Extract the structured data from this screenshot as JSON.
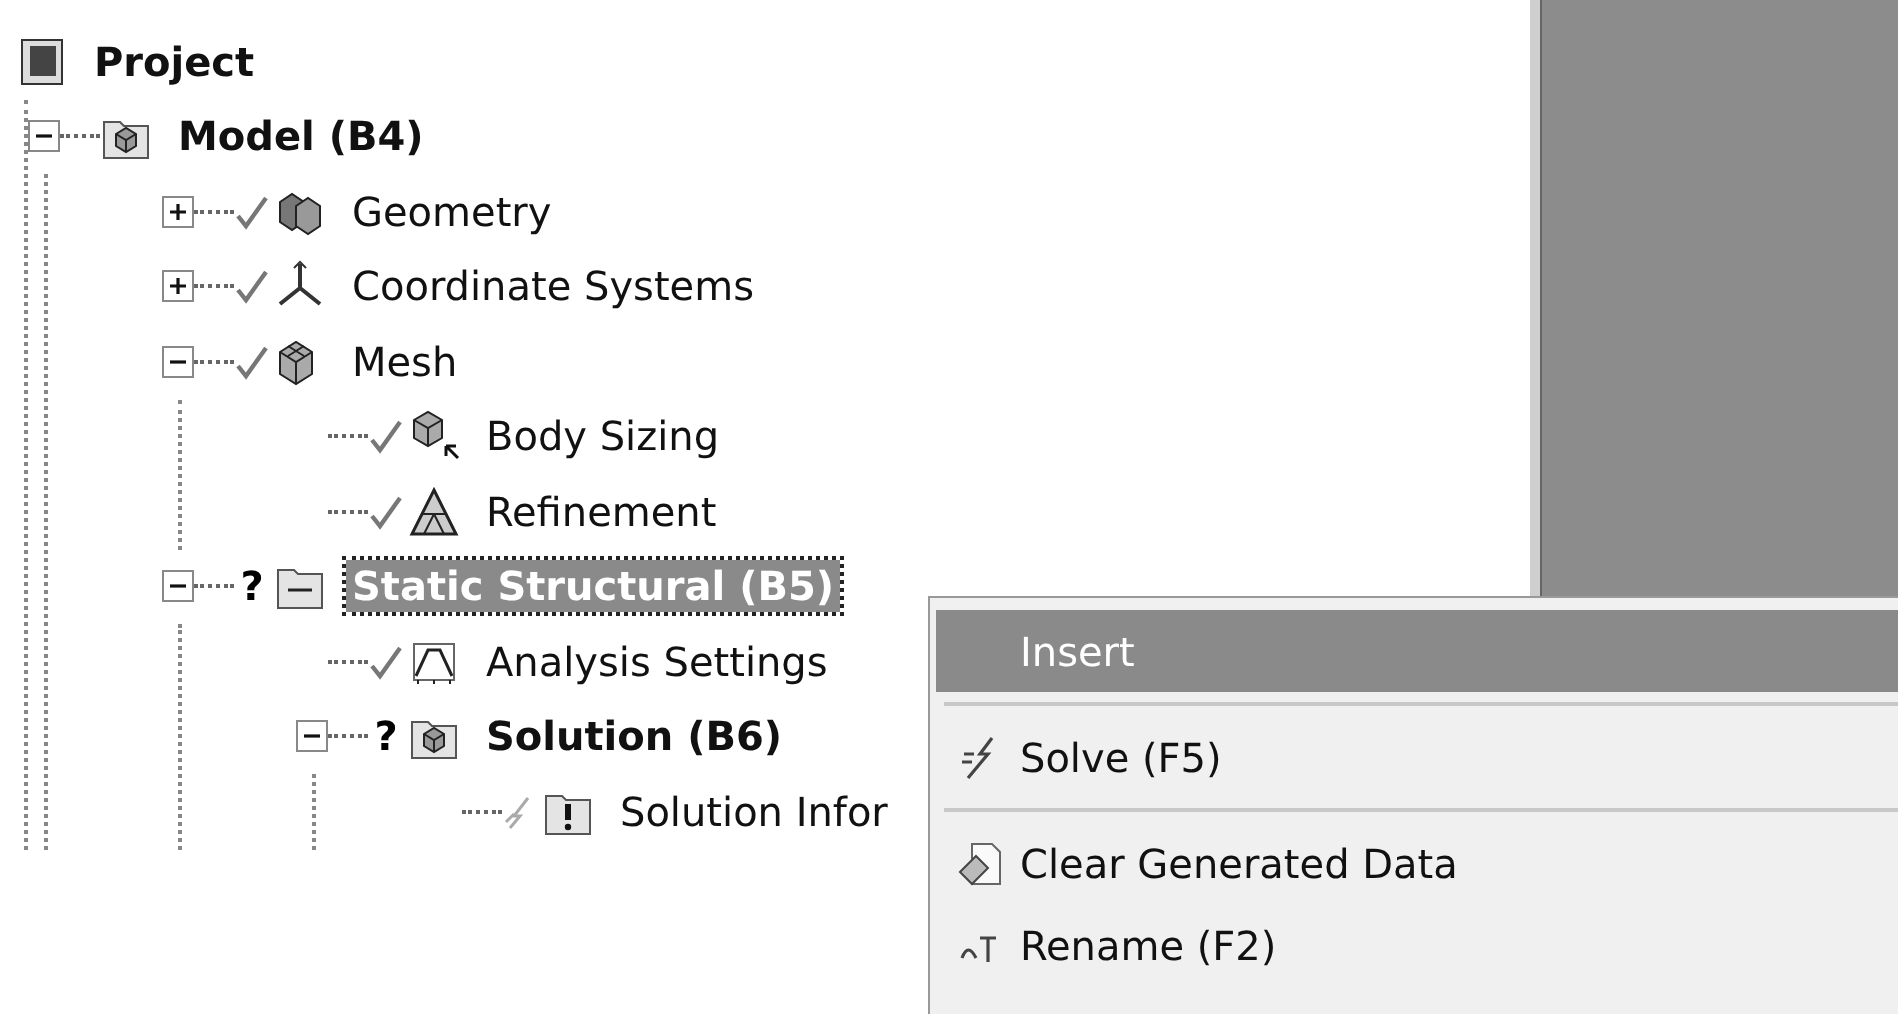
{
  "tree": [
    {
      "label": "Project",
      "kind": "project",
      "bold": true,
      "done": false,
      "selected": false,
      "children": [
        {
          "label": "Model (B4)",
          "kind": "model",
          "bold": true,
          "done": false,
          "expanded": true,
          "selected": false,
          "children": [
            {
              "label": "Geometry",
              "kind": "geometry",
              "bold": false,
              "done": true,
              "expanded": false,
              "selected": false
            },
            {
              "label": "Coordinate Systems",
              "kind": "coordinates",
              "bold": false,
              "done": true,
              "expanded": false,
              "selected": false
            },
            {
              "label": "Mesh",
              "kind": "mesh",
              "bold": false,
              "done": true,
              "expanded": true,
              "selected": false,
              "children": [
                {
                  "label": "Body Sizing",
                  "kind": "sizing",
                  "bold": false,
                  "done": true,
                  "selected": false
                },
                {
                  "label": "Refinement",
                  "kind": "refinement",
                  "bold": false,
                  "done": true,
                  "selected": false
                }
              ]
            },
            {
              "label": "Static Structural (B5)",
              "kind": "environment",
              "marker": "?",
              "bold": true,
              "done": false,
              "expanded": true,
              "selected": true,
              "children": [
                {
                  "label": "Analysis Settings",
                  "kind": "analysis",
                  "bold": false,
                  "done": true,
                  "selected": false
                },
                {
                  "label": "Solution (B6)",
                  "kind": "model",
                  "marker": "?",
                  "bold": true,
                  "done": false,
                  "expanded": true,
                  "selected": false,
                  "children": [
                    {
                      "label": "Solution Infor",
                      "kind": "info",
                      "bold": false,
                      "done": false,
                      "solving": true,
                      "selected": false
                    }
                  ]
                }
              ]
            }
          ]
        }
      ]
    }
  ],
  "context_menu": [
    {
      "kind": "item",
      "label": "Insert",
      "selected": true
    },
    {
      "kind": "separator"
    },
    {
      "kind": "item",
      "label": "Solve (F5)",
      "selected": false
    },
    {
      "kind": "separator"
    },
    {
      "kind": "item",
      "label": "Clear Generated Data",
      "selected": false
    },
    {
      "kind": "item",
      "label": "Rename (F2)",
      "selected": false
    }
  ]
}
